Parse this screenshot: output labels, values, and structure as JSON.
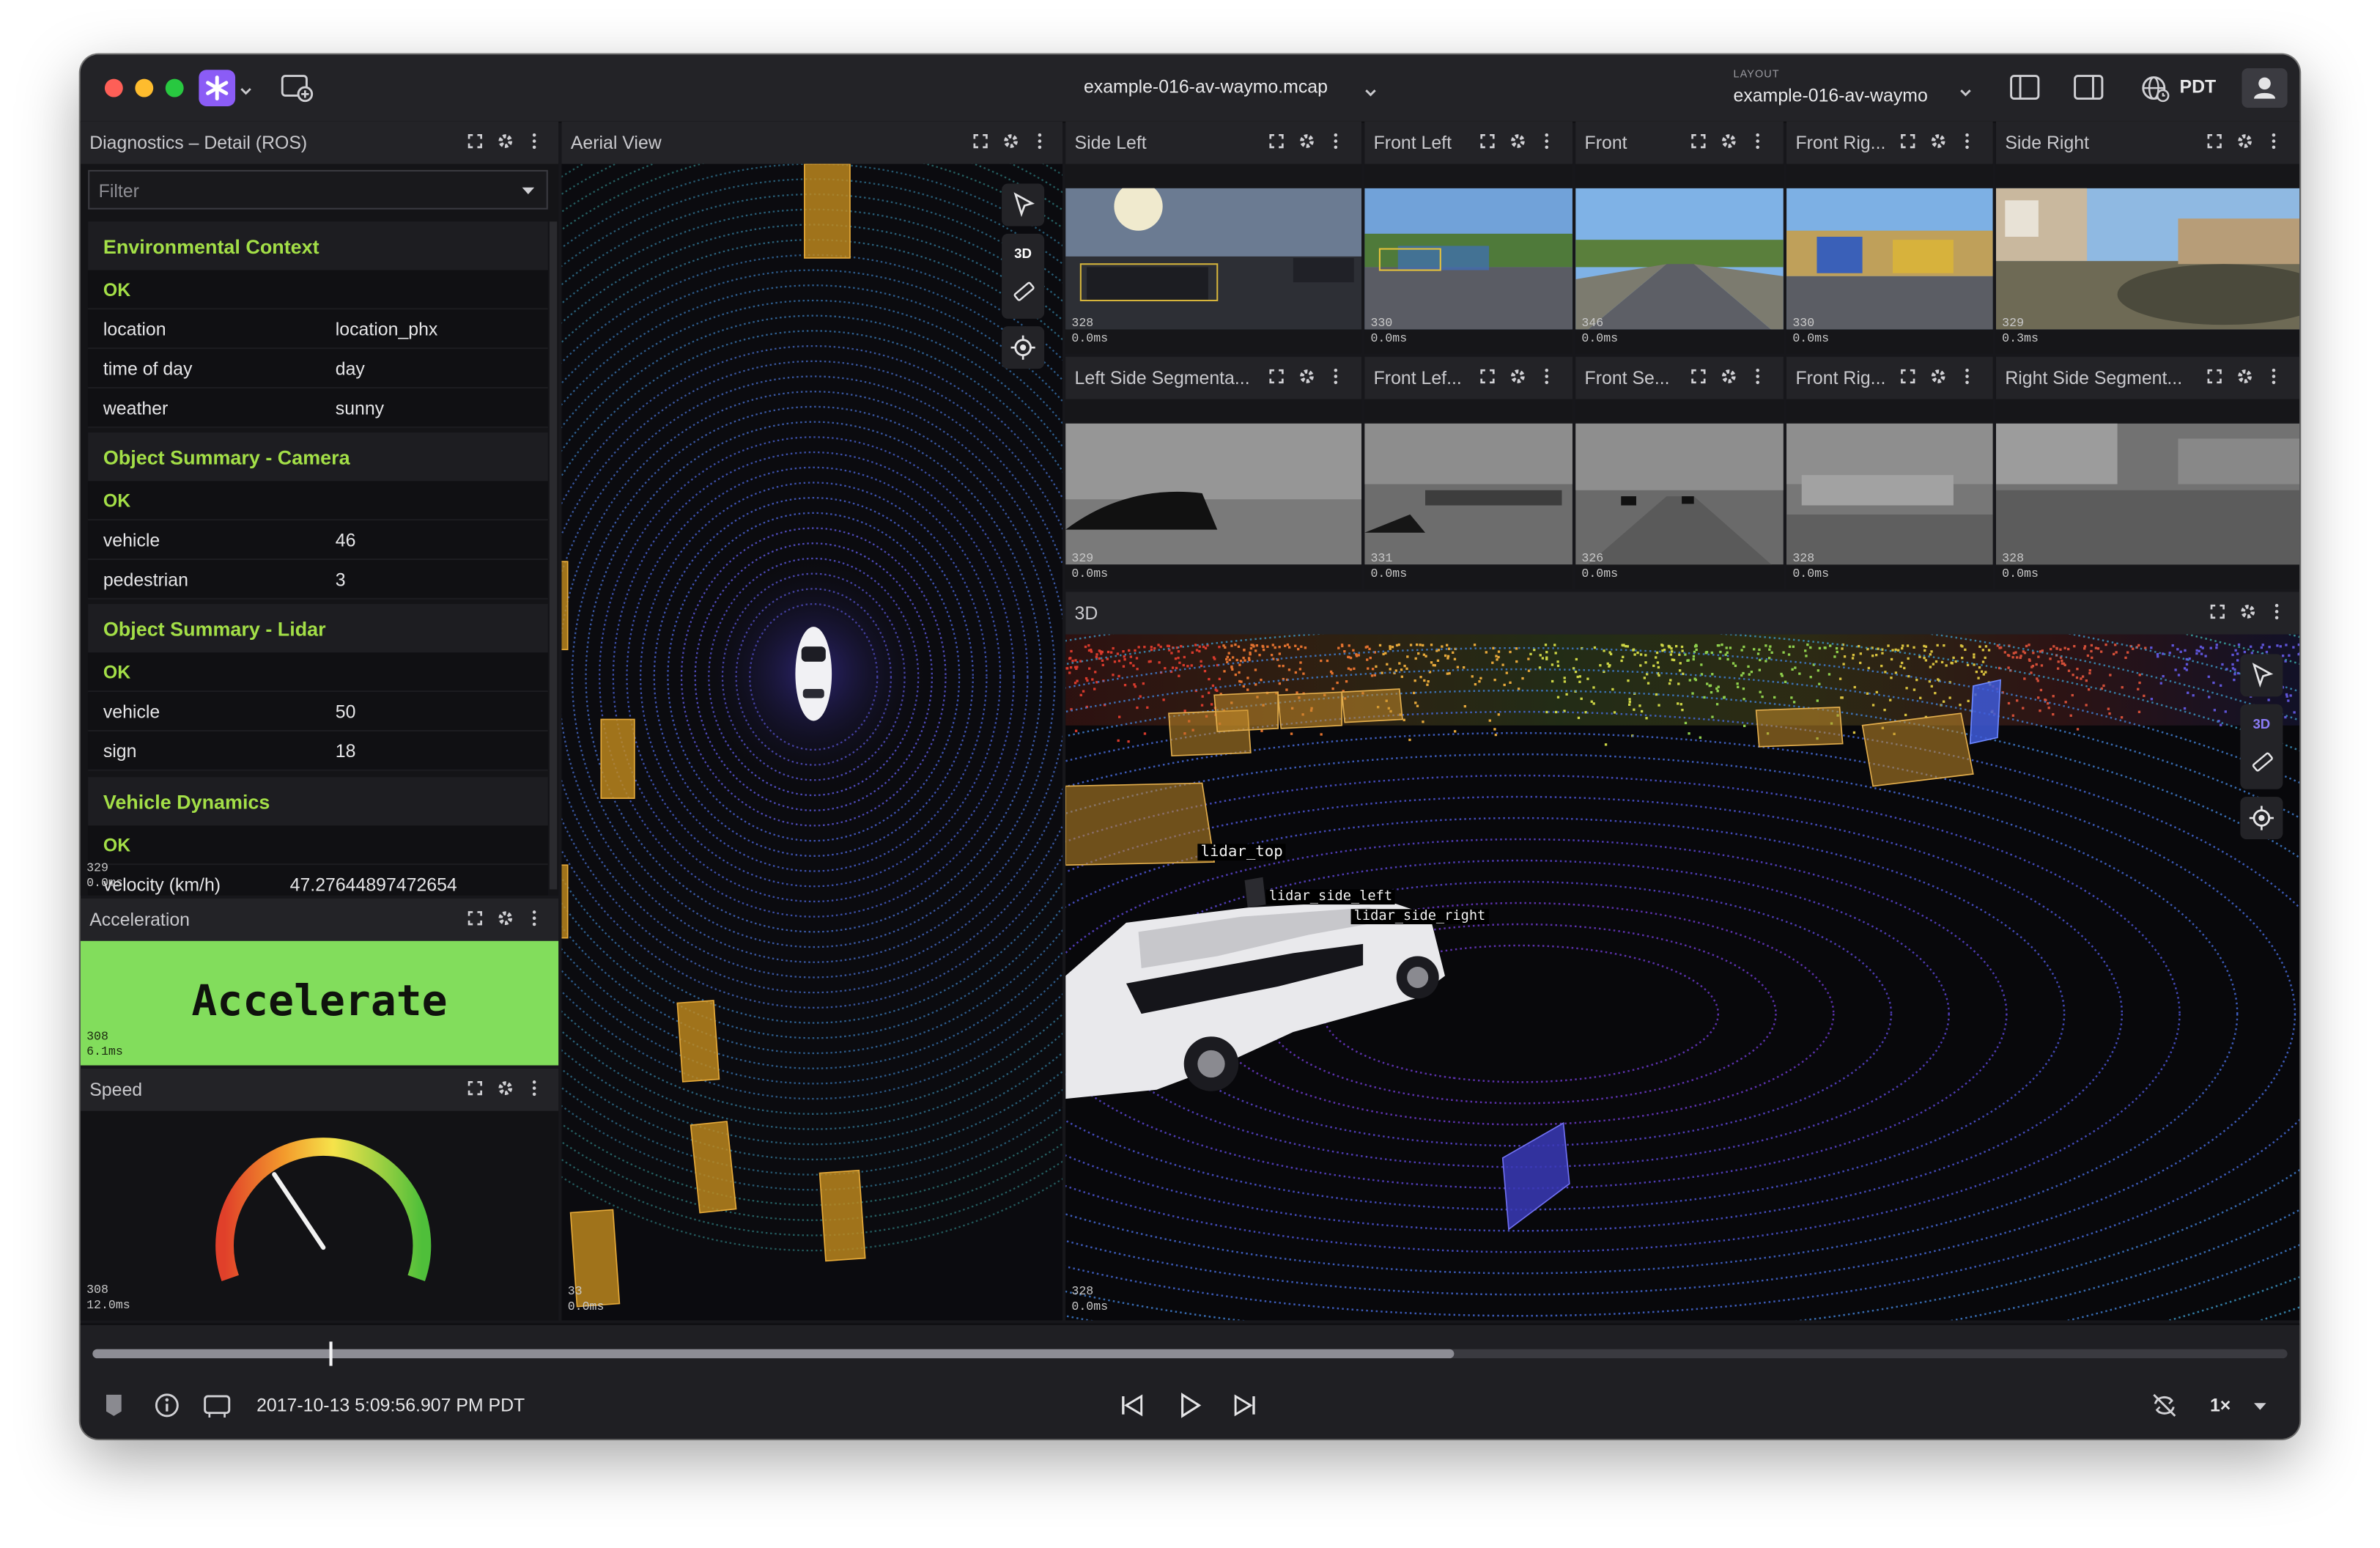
{
  "window": {
    "file_name": "example-016-av-waymo.mcap",
    "layout_label": "LAYOUT",
    "layout_name": "example-016-av-waymo",
    "timezone": "PDT"
  },
  "diagnostics": {
    "title": "Diagnostics – Detail (ROS)",
    "filter_placeholder": "Filter",
    "sections": [
      {
        "title": "Environmental Context",
        "status": "OK",
        "rows": [
          [
            "location",
            "location_phx"
          ],
          [
            "time of day",
            "day"
          ],
          [
            "weather",
            "sunny"
          ]
        ]
      },
      {
        "title": "Object Summary - Camera",
        "status": "OK",
        "rows": [
          [
            "vehicle",
            "46"
          ],
          [
            "pedestrian",
            "3"
          ]
        ]
      },
      {
        "title": "Object Summary - Lidar",
        "status": "OK",
        "rows": [
          [
            "vehicle",
            "50"
          ],
          [
            "sign",
            "18"
          ]
        ]
      },
      {
        "title": "Vehicle Dynamics",
        "status": "OK",
        "rows": [
          [
            "velocity (km/h)",
            "47.27644897472654"
          ]
        ]
      }
    ],
    "ts_a": "329",
    "ts_b": "0.0ms"
  },
  "acceleration": {
    "title": "Acceleration",
    "label": "Accelerate",
    "ts_a": "308",
    "ts_b": "6.1ms",
    "color": "#82dd5c"
  },
  "speed": {
    "title": "Speed",
    "ts_a": "308",
    "ts_b": "12.0ms",
    "gauge_fraction": 0.37
  },
  "aerial": {
    "title": "Aerial View",
    "mode_label": "3D",
    "ts_a": "33",
    "ts_b": "0.0ms"
  },
  "cameras": [
    {
      "title": "Side Left",
      "ts_a": "328",
      "ts_b": "0.0ms"
    },
    {
      "title": "Front Left",
      "ts_a": "330",
      "ts_b": "0.0ms"
    },
    {
      "title": "Front",
      "ts_a": "346",
      "ts_b": "0.0ms"
    },
    {
      "title": "Front Rig...",
      "ts_a": "330",
      "ts_b": "0.0ms"
    },
    {
      "title": "Side Right",
      "ts_a": "329",
      "ts_b": "0.3ms"
    }
  ],
  "segmentations": [
    {
      "title": "Left Side Segmenta...",
      "ts_a": "329",
      "ts_b": "0.0ms"
    },
    {
      "title": "Front Lef...",
      "ts_a": "331",
      "ts_b": "0.0ms"
    },
    {
      "title": "Front Se...",
      "ts_a": "326",
      "ts_b": "0.0ms"
    },
    {
      "title": "Front Rig...",
      "ts_a": "328",
      "ts_b": "0.0ms"
    },
    {
      "title": "Right Side Segment...",
      "ts_a": "328",
      "ts_b": "0.0ms"
    }
  ],
  "view3d": {
    "title": "3D",
    "mode_label": "3D",
    "labels": {
      "lidar_top": "lidar_top",
      "lidar_side_left": "lidar_side_left",
      "lidar_side_right": "lidar_side_right"
    },
    "ts_a": "328",
    "ts_b": "0.0ms"
  },
  "playback": {
    "timestamp": "2017-10-13 5:09:56.907 PM PDT",
    "speed_label": "1×",
    "buffered_fraction": 0.62,
    "position_fraction": 0.108
  }
}
